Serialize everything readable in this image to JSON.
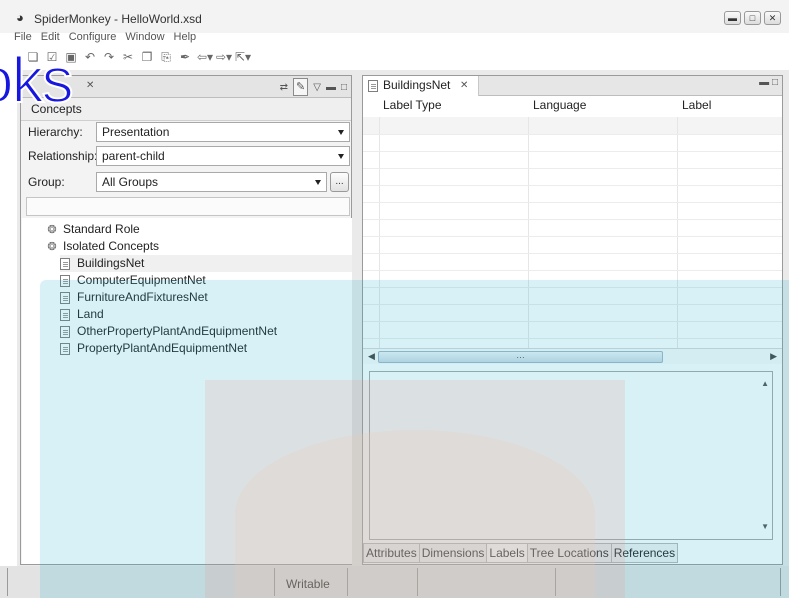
{
  "window": {
    "title": "SpiderMonkey - HelloWorld.xsd",
    "controls": [
      "minimize-icon",
      "maximize-icon",
      "close-icon"
    ]
  },
  "menu": {
    "items": [
      "File",
      "Edit",
      "Configure",
      "Window",
      "Help"
    ]
  },
  "toolbar": {
    "icons": [
      "new-file-icon",
      "open-folder-icon",
      "checkbox-icon",
      "save-icon",
      "undo-icon",
      "redo-icon",
      "cut-icon",
      "copy-icon",
      "paste-icon",
      "brush-icon",
      "back-icon",
      "forward-icon",
      "export-icon"
    ]
  },
  "concepts_panel": {
    "heading": "Concepts",
    "hierarchy": {
      "label": "Hierarchy:",
      "value": "Presentation"
    },
    "relationship": {
      "label": "Relationship:",
      "value": "parent-child"
    },
    "group": {
      "label": "Group:",
      "value": "All Groups",
      "button": "..."
    },
    "tree": [
      {
        "label": "Standard Role",
        "kind": "group"
      },
      {
        "label": "Isolated Concepts",
        "kind": "group"
      },
      {
        "label": "BuildingsNet",
        "kind": "concept",
        "selected": true
      },
      {
        "label": "ComputerEquipmentNet",
        "kind": "concept"
      },
      {
        "label": "FurnitureAndFixturesNet",
        "kind": "concept"
      },
      {
        "label": "Land",
        "kind": "concept"
      },
      {
        "label": "OtherPropertyPlantAndEquipmentNet",
        "kind": "concept"
      },
      {
        "label": "PropertyPlantAndEquipmentNet",
        "kind": "concept"
      }
    ]
  },
  "editor": {
    "tab": "BuildingsNet",
    "table": {
      "columns": [
        "Label Type",
        "Language",
        "Label"
      ],
      "rows": []
    },
    "bottom_tabs": [
      {
        "label": "Attributes",
        "active": false
      },
      {
        "label": "Dimensions",
        "active": false
      },
      {
        "label": "Labels",
        "active": true
      },
      {
        "label": "Tree Locations",
        "active": false
      },
      {
        "label": "References",
        "active": false
      }
    ]
  },
  "status": {
    "text": "Writable"
  },
  "watermark": {
    "text": "oks"
  }
}
